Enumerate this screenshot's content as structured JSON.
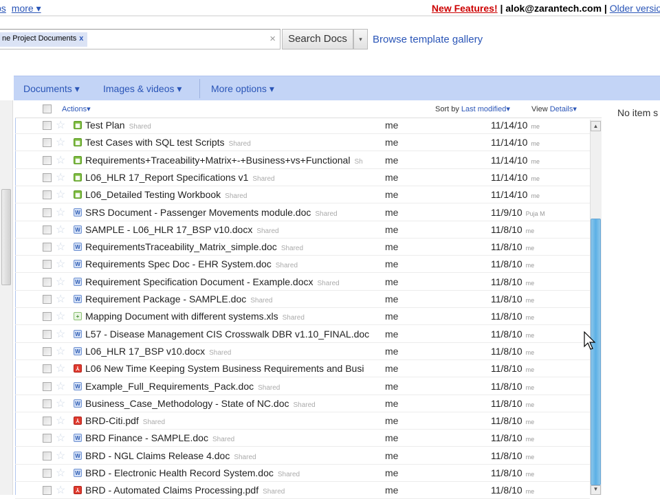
{
  "topbar": {
    "left_links": [
      "ps",
      "more ▾"
    ],
    "new_features": "New Features!",
    "sep1": " | ",
    "user": "alok@zarantech.com",
    "sep2": " | ",
    "older_version": "Older version"
  },
  "search": {
    "chip_label": "ne Project Documents",
    "chip_close": "x",
    "clear": "×",
    "button": "Search Docs",
    "dropdown": "▾",
    "browse": "Browse template gallery"
  },
  "toolbar": {
    "documents": "Documents ▾",
    "images": "Images & videos ▾",
    "more": "More options ▾"
  },
  "list_header": {
    "actions": "Actions▾",
    "sort_prefix": "Sort by ",
    "sort_value": "Last modified▾",
    "view_prefix": "View ",
    "view_value": "Details▾"
  },
  "right_panel": {
    "text": "No item s"
  },
  "rows": [
    {
      "type": "sheet",
      "name": "Test Plan",
      "shared": "Shared",
      "owner": "me",
      "date": "11/14/10",
      "by": "me"
    },
    {
      "type": "sheet",
      "name": "Test Cases with SQL test Scripts",
      "shared": "Shared",
      "owner": "me",
      "date": "11/14/10",
      "by": "me"
    },
    {
      "type": "sheet",
      "name": "Requirements+Traceability+Matrix+-+Business+vs+Functional",
      "shared": "Sh",
      "owner": "me",
      "date": "11/14/10",
      "by": "me"
    },
    {
      "type": "sheet",
      "name": "L06_HLR 17_Report Specifications v1",
      "shared": "Shared",
      "owner": "me",
      "date": "11/14/10",
      "by": "me"
    },
    {
      "type": "sheet",
      "name": "L06_Detailed Testing Workbook",
      "shared": "Shared",
      "owner": "me",
      "date": "11/14/10",
      "by": "me"
    },
    {
      "type": "doc",
      "name": "SRS Document - Passenger Movements module.doc",
      "shared": "Shared",
      "owner": "me",
      "date": "11/9/10",
      "by": "Puja M"
    },
    {
      "type": "doc",
      "name": "SAMPLE - L06_HLR 17_BSP v10.docx",
      "shared": "Shared",
      "owner": "me",
      "date": "11/8/10",
      "by": "me"
    },
    {
      "type": "doc",
      "name": "RequirementsTraceability_Matrix_simple.doc",
      "shared": "Shared",
      "owner": "me",
      "date": "11/8/10",
      "by": "me"
    },
    {
      "type": "doc",
      "name": "Requirements Spec Doc - EHR System.doc",
      "shared": "Shared",
      "owner": "me",
      "date": "11/8/10",
      "by": "me"
    },
    {
      "type": "doc",
      "name": "Requirement Specification Document - Example.docx",
      "shared": "Shared",
      "owner": "me",
      "date": "11/8/10",
      "by": "me"
    },
    {
      "type": "doc",
      "name": "Requirement Package - SAMPLE.doc",
      "shared": "Shared",
      "owner": "me",
      "date": "11/8/10",
      "by": "me"
    },
    {
      "type": "xls",
      "name": "Mapping Document with different systems.xls",
      "shared": "Shared",
      "owner": "me",
      "date": "11/8/10",
      "by": "me"
    },
    {
      "type": "doc",
      "name": "L57 - Disease Management CIS Crosswalk DBR v1.10_FINAL.doc",
      "shared": "",
      "owner": "me",
      "date": "11/8/10",
      "by": "me"
    },
    {
      "type": "doc",
      "name": "L06_HLR 17_BSP v10.docx",
      "shared": "Shared",
      "owner": "me",
      "date": "11/8/10",
      "by": "me"
    },
    {
      "type": "pdf",
      "name": "L06 New Time Keeping System Business Requirements and Busi",
      "shared": "",
      "owner": "me",
      "date": "11/8/10",
      "by": "me"
    },
    {
      "type": "doc",
      "name": "Example_Full_Requirements_Pack.doc",
      "shared": "Shared",
      "owner": "me",
      "date": "11/8/10",
      "by": "me"
    },
    {
      "type": "doc",
      "name": "Business_Case_Methodology - State of NC.doc",
      "shared": "Shared",
      "owner": "me",
      "date": "11/8/10",
      "by": "me"
    },
    {
      "type": "pdf",
      "name": "BRD-Citi.pdf",
      "shared": "Shared",
      "owner": "me",
      "date": "11/8/10",
      "by": "me"
    },
    {
      "type": "doc",
      "name": "BRD Finance - SAMPLE.doc",
      "shared": "Shared",
      "owner": "me",
      "date": "11/8/10",
      "by": "me"
    },
    {
      "type": "doc",
      "name": "BRD - NGL Claims Release 4.doc",
      "shared": "Shared",
      "owner": "me",
      "date": "11/8/10",
      "by": "me"
    },
    {
      "type": "doc",
      "name": "BRD - Electronic Health Record System.doc",
      "shared": "Shared",
      "owner": "me",
      "date": "11/8/10",
      "by": "me"
    },
    {
      "type": "pdf",
      "name": "BRD - Automated Claims Processing.pdf",
      "shared": "Shared",
      "owner": "me",
      "date": "11/8/10",
      "by": "me"
    }
  ],
  "scroll": {
    "position_fraction": 0.28,
    "visible_fraction": 0.72
  }
}
